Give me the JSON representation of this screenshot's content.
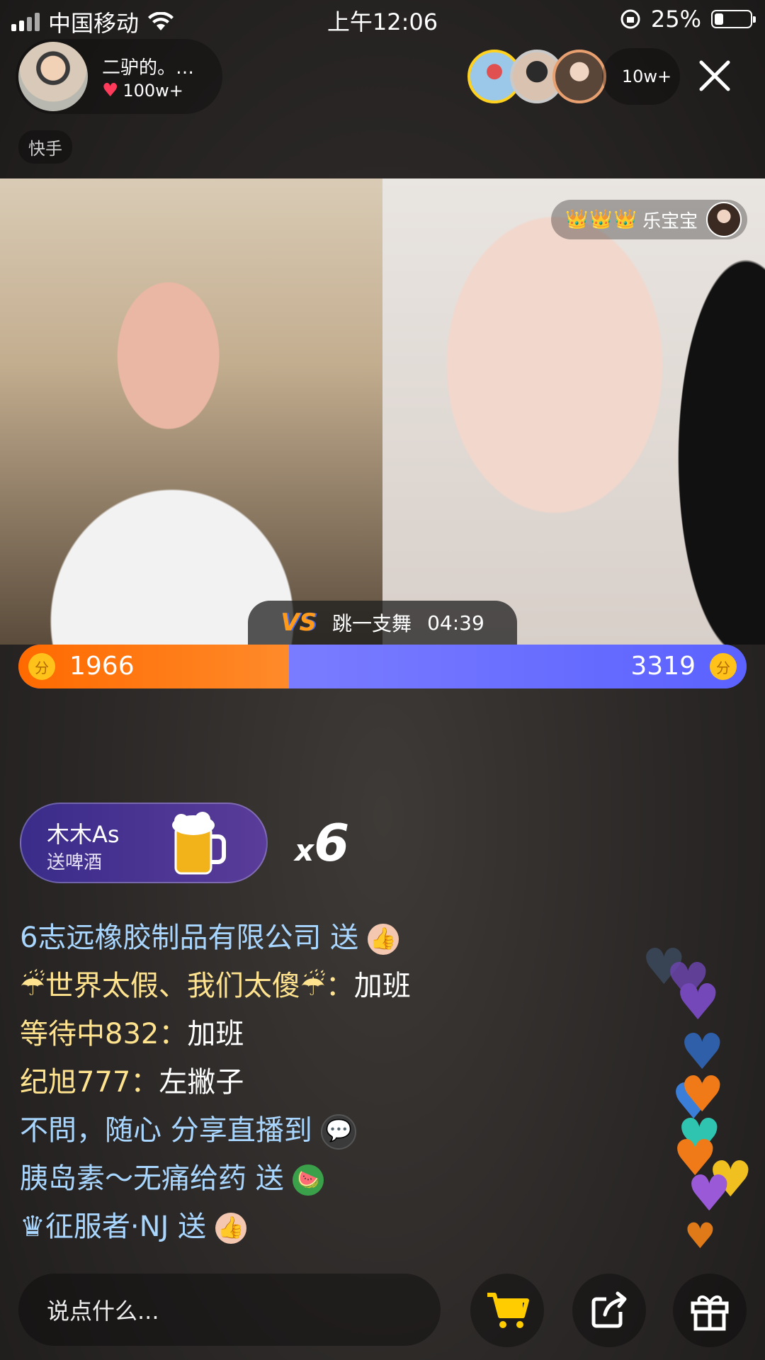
{
  "status_bar": {
    "carrier": "中国移动",
    "time": "上午12:06",
    "battery": "25%"
  },
  "host": {
    "name": "二驴的。…",
    "likes": "100w+"
  },
  "brand_tag": "快手",
  "viewers": {
    "count": "10w+"
  },
  "guest": {
    "crowns": "👑👑👑",
    "name": "乐宝宝"
  },
  "pk": {
    "task": "跳一支舞",
    "timer": "04:39",
    "left_score": "1966",
    "right_score": "3319",
    "coin_symbol": "分",
    "left_share": 0.372,
    "left_color": "#ff7a10",
    "right_color": "#6a6fff"
  },
  "gift": {
    "user": "木木As",
    "action": "送啤酒",
    "count_prefix": "x",
    "count": "6"
  },
  "comments": [
    {
      "user": "6志远橡胶制品有限公司 送",
      "text": "",
      "icon": "thumbs-up-icon",
      "glyph": "👍"
    },
    {
      "user": "☔世界太假、我们太傻☔：",
      "text": "加班"
    },
    {
      "user": "等待中832：",
      "text": "加班"
    },
    {
      "user": "纪旭777：",
      "text": "左撇子"
    },
    {
      "user": "不問，随心 分享直播到",
      "text": "",
      "icon": "wechat-icon",
      "glyph": "💬"
    },
    {
      "user": "胰岛素～无痛给药 送",
      "text": "",
      "icon": "watermelon-icon",
      "glyph": "🍉"
    },
    {
      "user": "♛征服者·NJ 送",
      "text": "",
      "icon": "thumbs-up-icon",
      "glyph": "👍"
    }
  ],
  "input": {
    "placeholder": "说点什么..."
  },
  "colors": {
    "accent_orange": "#ff7a10",
    "accent_blue": "#6a6fff",
    "username": "#ffe38f",
    "system_message": "#a8d6ff"
  }
}
